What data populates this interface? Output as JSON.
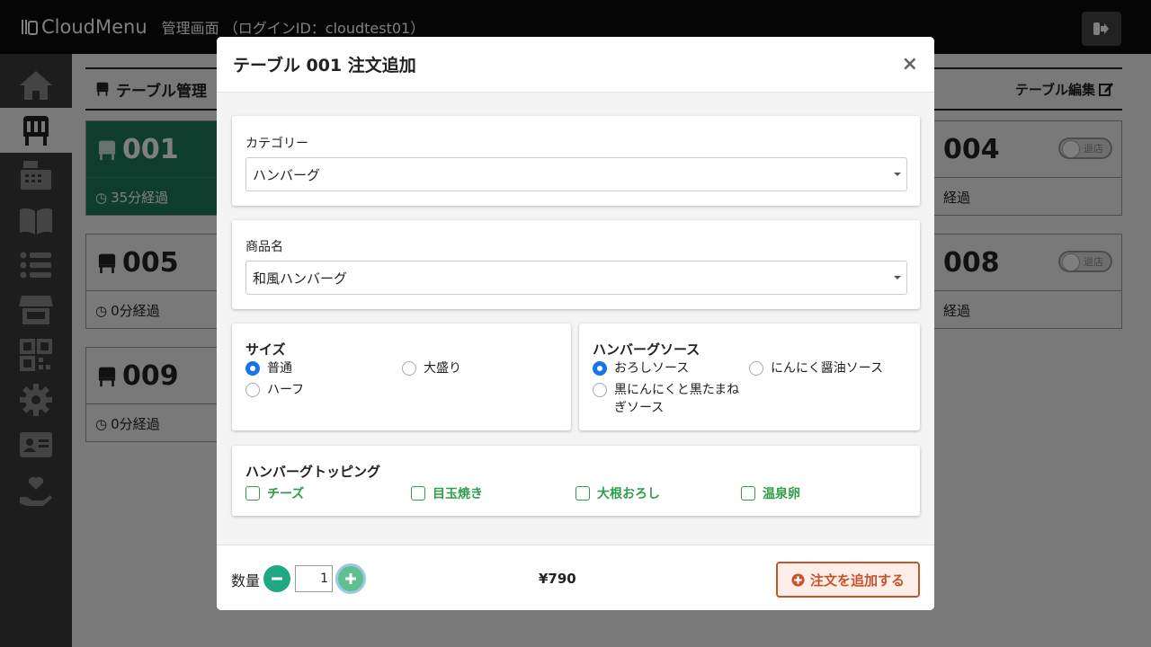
{
  "header": {
    "brand": "CloudMenu",
    "subtitle": "管理画面 （ログインID：cloudtest01）"
  },
  "sidebar": {
    "items": [
      {
        "icon": "home-icon"
      },
      {
        "icon": "chair-icon",
        "active": true
      },
      {
        "icon": "cash-register-icon"
      },
      {
        "icon": "menu-book-icon"
      },
      {
        "icon": "list-icon"
      },
      {
        "icon": "store-icon"
      },
      {
        "icon": "qrcode-icon"
      },
      {
        "icon": "gear-icon"
      },
      {
        "icon": "id-card-icon"
      },
      {
        "icon": "heart-hand-icon"
      }
    ]
  },
  "main": {
    "title": "テーブル管理",
    "edit_label": "テーブル編集",
    "cards": [
      {
        "num": "001",
        "elapsed": "35分経過"
      },
      {
        "num": "005",
        "elapsed": "0分経過"
      },
      {
        "num": "009",
        "elapsed": "0分経過"
      },
      {
        "num": "004",
        "elapsed": "経過",
        "toggle": "退店"
      },
      {
        "num": "008",
        "elapsed": "経過",
        "toggle": "退店"
      }
    ]
  },
  "modal": {
    "title": "テーブル 001 注文追加",
    "close": "×",
    "category_label": "カテゴリー",
    "category_value": "ハンバーグ",
    "product_label": "商品名",
    "product_value": "和風ハンバーグ",
    "size": {
      "title": "サイズ",
      "options": [
        "普通",
        "大盛り",
        "ハーフ"
      ],
      "selected": "普通"
    },
    "sauce": {
      "title": "ハンバーグソース",
      "options": [
        "おろしソース",
        "にんにく醤油ソース",
        "黒にんにくと黒たまね",
        "ぎソース"
      ],
      "selected": "おろしソース"
    },
    "topping": {
      "title": "ハンバーグトッピング",
      "options": [
        "チーズ",
        "目玉焼き",
        "大根おろし",
        "温泉卵"
      ]
    },
    "footer": {
      "qty_label": "数量",
      "qty_value": "1",
      "price": "¥790",
      "add_label": "注文を追加する"
    }
  },
  "colors": {
    "occupied": "#1d7b5b",
    "radio_on": "#1a73e8",
    "topping": "#2e9e4a",
    "add_button": "#c4532e"
  }
}
